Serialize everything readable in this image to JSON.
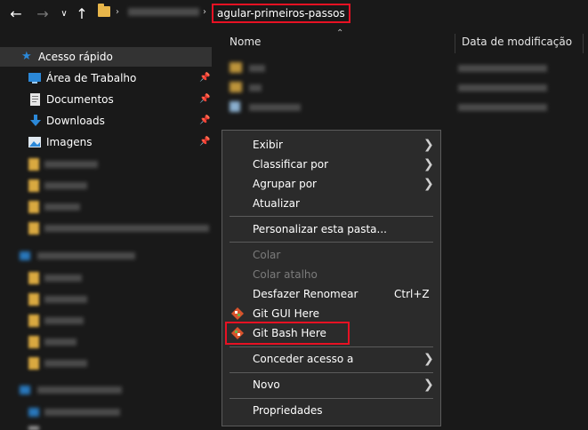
{
  "toolbar": {
    "back_icon": "arrow-left-icon",
    "forward_icon": "arrow-right-icon",
    "recent_icon": "chevron-down-icon",
    "up_icon": "arrow-up-icon"
  },
  "breadcrumb": {
    "current": "agular-primeiros-passos"
  },
  "sidebar": {
    "quick_access": "Acesso rápido",
    "items": [
      {
        "label": "Área de Trabalho",
        "icon": "desktop-icon",
        "pinned": true
      },
      {
        "label": "Documentos",
        "icon": "documents-icon",
        "pinned": true
      },
      {
        "label": "Downloads",
        "icon": "download-icon",
        "pinned": true
      },
      {
        "label": "Imagens",
        "icon": "pictures-icon",
        "pinned": true
      }
    ]
  },
  "columns": {
    "name": "Nome",
    "modified": "Data de modificação"
  },
  "context_menu": {
    "items": [
      {
        "label": "Exibir",
        "submenu": true
      },
      {
        "label": "Classificar por",
        "submenu": true
      },
      {
        "label": "Agrupar por",
        "submenu": true
      },
      {
        "label": "Atualizar"
      },
      {
        "label": "Personalizar esta pasta..."
      },
      {
        "label": "Colar",
        "disabled": true
      },
      {
        "label": "Colar atalho",
        "disabled": true
      },
      {
        "label": "Desfazer Renomear",
        "shortcut": "Ctrl+Z"
      },
      {
        "label": "Git GUI Here",
        "icon": "git-gui-icon"
      },
      {
        "label": "Git Bash Here",
        "icon": "git-bash-icon"
      },
      {
        "label": "Conceder acesso a",
        "submenu": true
      },
      {
        "label": "Novo",
        "submenu": true
      },
      {
        "label": "Propriedades"
      }
    ]
  },
  "colors": {
    "background": "#191919",
    "menu_background": "#2b2b2b",
    "highlight": "#e81123",
    "folder": "#e8b64a",
    "accent": "#2b88d8"
  }
}
